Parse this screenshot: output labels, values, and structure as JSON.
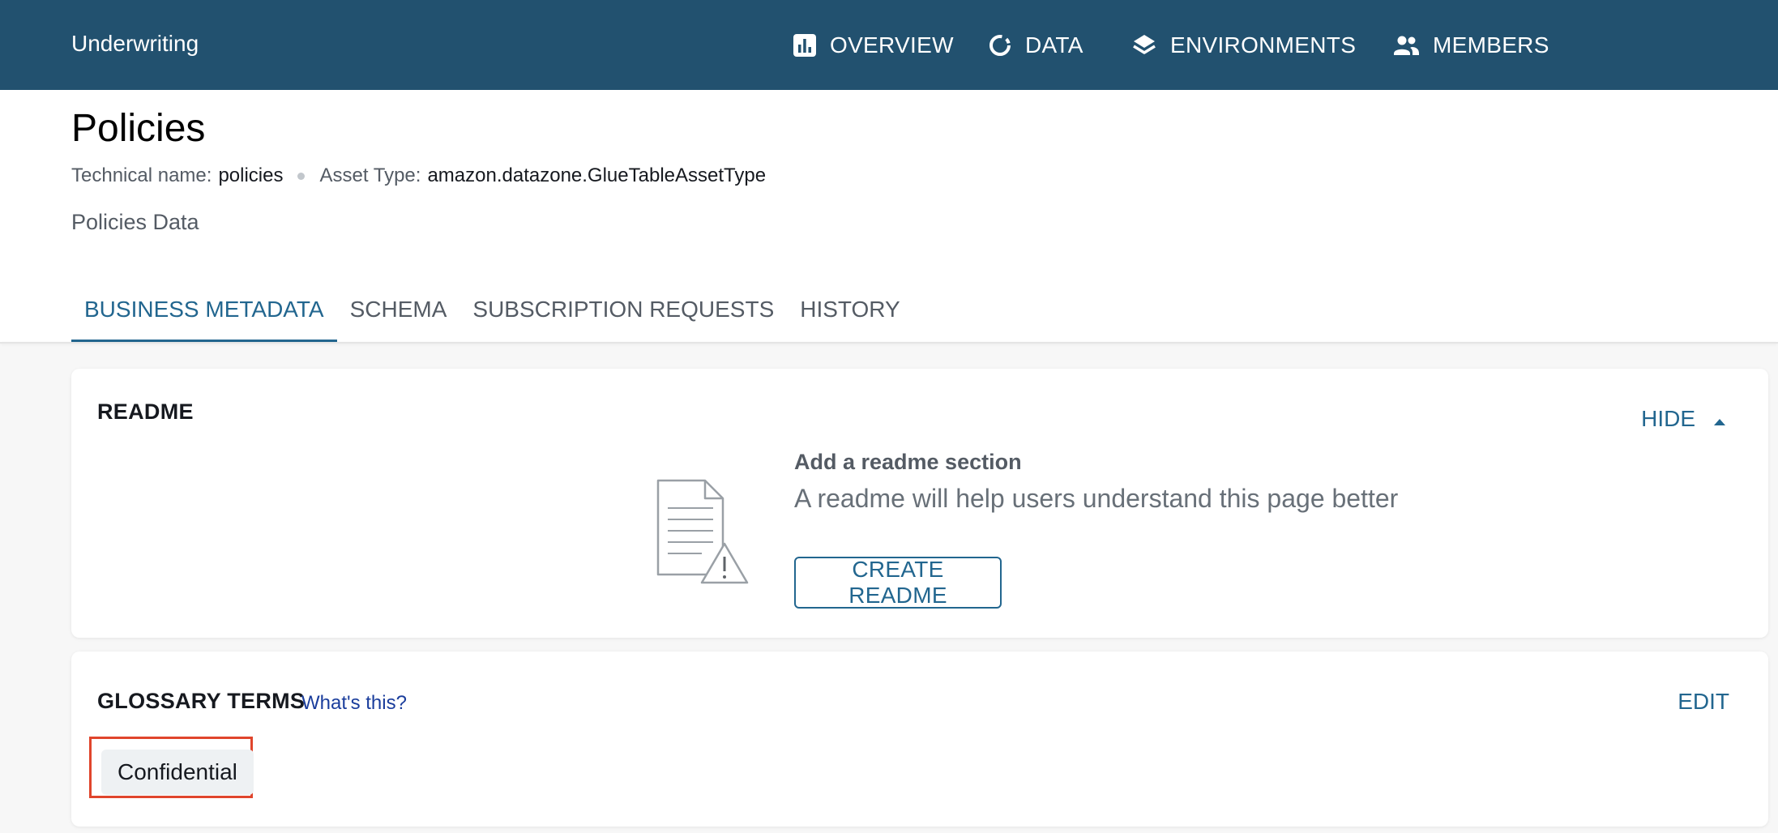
{
  "project": {
    "name": "Underwriting"
  },
  "nav": {
    "tabs": [
      {
        "label": "OVERVIEW",
        "icon": "bar-chart-icon",
        "active": false
      },
      {
        "label": "DATA",
        "icon": "donut-icon",
        "active": true
      },
      {
        "label": "ENVIRONMENTS",
        "icon": "layers-icon",
        "active": false
      },
      {
        "label": "MEMBERS",
        "icon": "people-icon",
        "active": false
      }
    ]
  },
  "asset": {
    "title": "Policies",
    "technical_name_label": "Technical name:",
    "technical_name": "policies",
    "asset_type_label": "Asset Type:",
    "asset_type": "amazon.datazone.GlueTableAssetType",
    "description": "Policies Data"
  },
  "subtabs": [
    {
      "label": "BUSINESS METADATA",
      "active": true
    },
    {
      "label": "SCHEMA",
      "active": false
    },
    {
      "label": "SUBSCRIPTION REQUESTS",
      "active": false
    },
    {
      "label": "HISTORY",
      "active": false
    }
  ],
  "readme": {
    "title": "README",
    "toggle_label": "HIDE",
    "empty_heading": "Add a readme section",
    "empty_text": "A readme will help users understand this page better",
    "create_button": "CREATE README"
  },
  "glossary": {
    "title": "GLOSSARY TERMS",
    "help_link": "What's this?",
    "edit_label": "EDIT",
    "terms": [
      "Confidential"
    ]
  },
  "colors": {
    "nav_bg": "#22516f",
    "accent": "#22668f",
    "highlight": "#e0452c"
  }
}
